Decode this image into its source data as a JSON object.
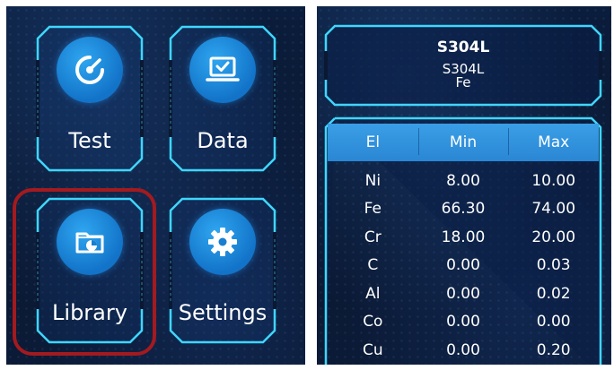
{
  "menu": {
    "tiles": [
      {
        "label": "Test",
        "icon": "gauge-icon"
      },
      {
        "label": "Data",
        "icon": "laptop-check-icon"
      },
      {
        "label": "Library",
        "icon": "folder-chart-icon"
      },
      {
        "label": "Settings",
        "icon": "gear-icon"
      }
    ],
    "highlighted": "Library",
    "highlight_color": "#a31a1f"
  },
  "alloy": {
    "name": "S304L",
    "grade": "S304L",
    "base": "Fe"
  },
  "table": {
    "headers": [
      "El",
      "Min",
      "Max"
    ],
    "rows": [
      [
        "Ni",
        "8.00",
        "10.00"
      ],
      [
        "Fe",
        "66.30",
        "74.00"
      ],
      [
        "Cr",
        "18.00",
        "20.00"
      ],
      [
        "C",
        "0.00",
        "0.03"
      ],
      [
        "Al",
        "0.00",
        "0.02"
      ],
      [
        "Co",
        "0.00",
        "0.00"
      ],
      [
        "Cu",
        "0.00",
        "0.20"
      ]
    ]
  },
  "colors": {
    "accent": "#3fd6ff",
    "header_blue": "#2a86d4",
    "background": "#0a1832"
  }
}
